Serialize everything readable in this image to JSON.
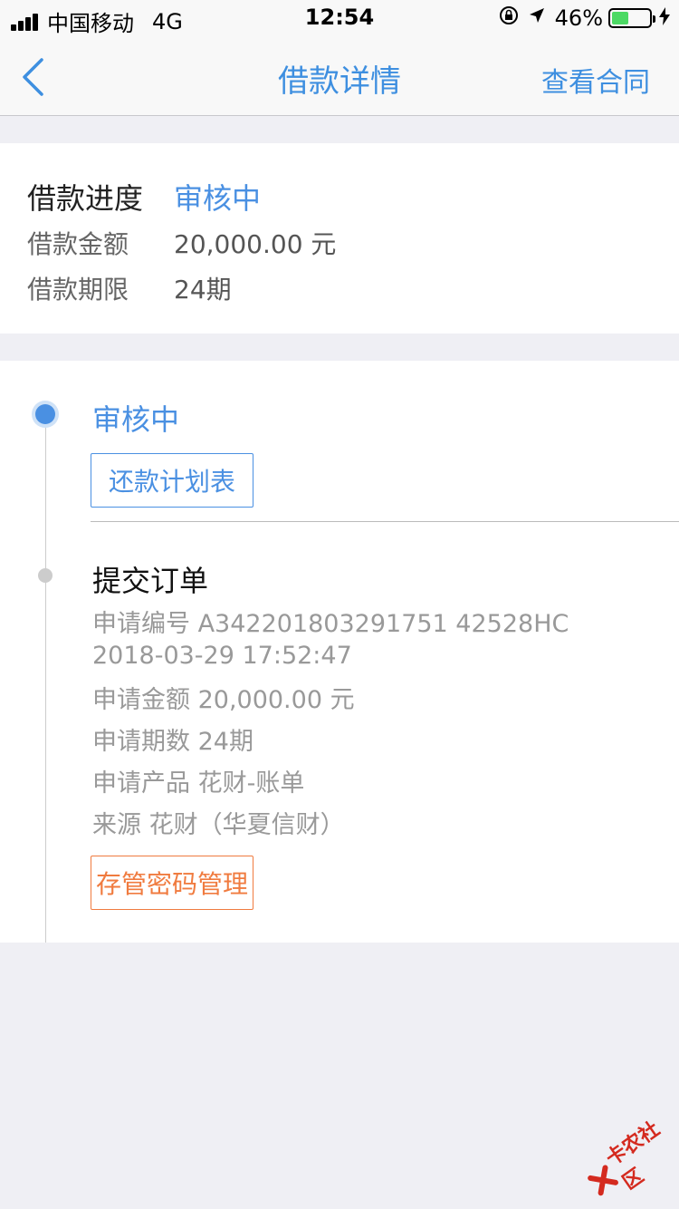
{
  "status_bar": {
    "carrier": "中国移动",
    "network": "4G",
    "time": "12:54",
    "battery_percent_label": "46%",
    "battery_level": 0.46,
    "battery_color": "#4cd964"
  },
  "nav": {
    "back_icon": "chevron-left-icon",
    "title": "借款详情",
    "action_label": "查看合同",
    "accent_color": "#3e8fe0"
  },
  "summary": {
    "progress_label": "借款进度",
    "progress_value": "审核中",
    "amount_label": "借款金额",
    "amount_value": "20,000.00 元",
    "term_label": "借款期限",
    "term_value": "24期"
  },
  "timeline": {
    "steps": [
      {
        "title": "审核中",
        "button_label": "还款计划表"
      },
      {
        "title": "提交订单",
        "lines": [
          "申请编号 A342201803291751 42528HC",
          "2018-03-29 17:52:47",
          "申请金额 20,000.00 元",
          "申请期数 24期",
          "申请产品 花财-账单",
          "来源 花财（华夏信财）"
        ],
        "button_label": "存管密码管理"
      }
    ]
  },
  "watermark": {
    "text": "卡农社区"
  }
}
